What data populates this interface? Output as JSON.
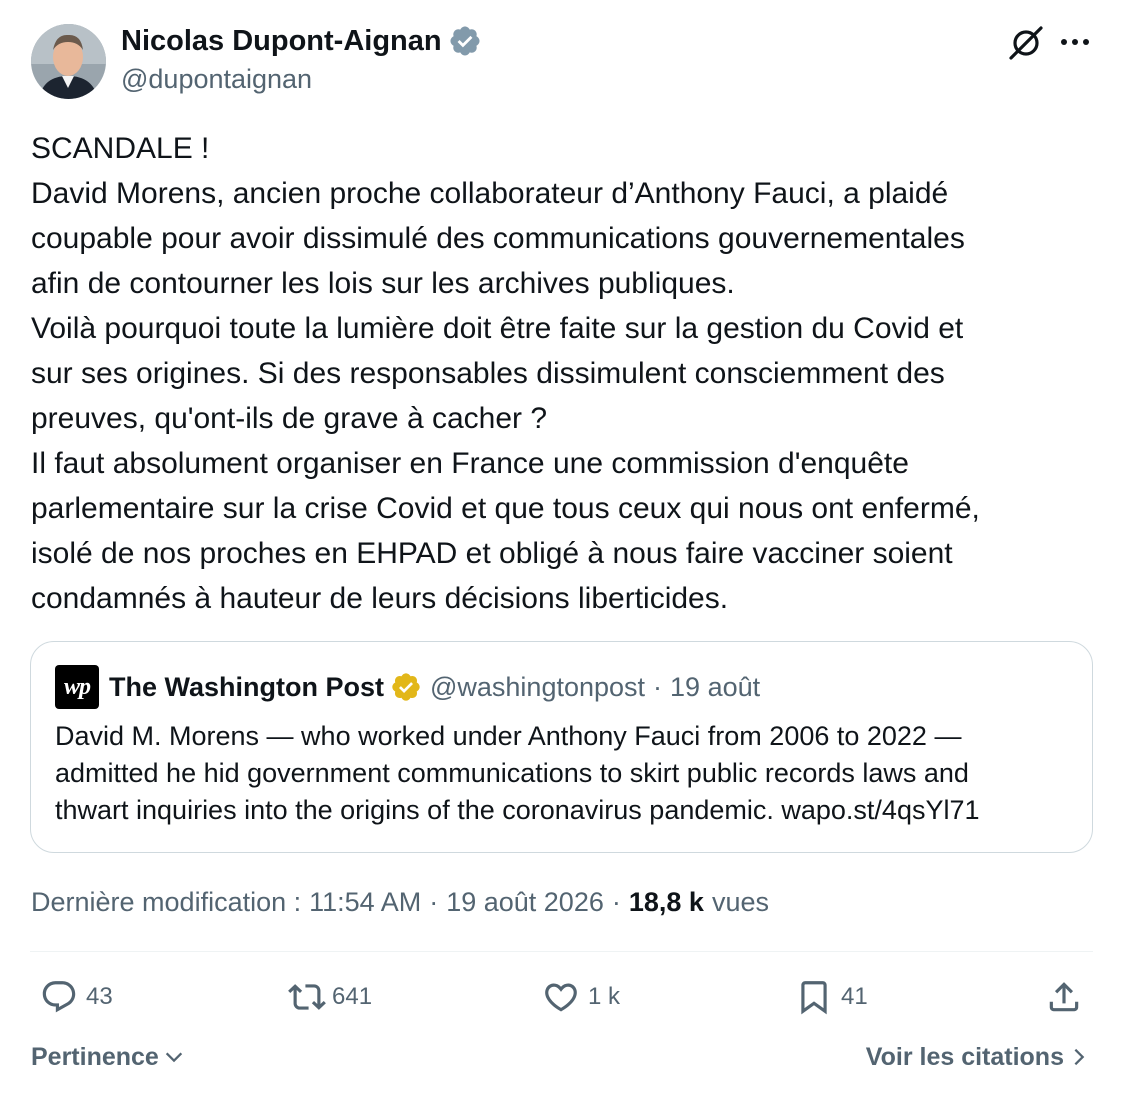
{
  "author": {
    "name": "Nicolas Dupont-Aignan",
    "handle": "@dupontaignan",
    "verified_color": "#829aab"
  },
  "tweet": {
    "lines": [
      "SCANDALE !",
      "David Morens, ancien proche collaborateur d’Anthony Fauci, a plaidé",
      "coupable pour avoir dissimulé des communications gouvernementales",
      "afin de contourner les lois sur les archives publiques.",
      "Voilà pourquoi toute la lumière doit être faite sur la gestion du Covid et",
      "sur ses origines. Si des responsables dissimulent consciemment des",
      "preuves, qu'ont-ils de grave à cacher ?",
      "Il faut absolument organiser en France une commission d'enquête",
      "parlementaire sur la crise Covid et que tous ceux qui nous ont enfermé,",
      "isolé de nos proches en EHPAD et obligé à nous faire vacciner soient",
      "condamnés à hauteur de leurs décisions liberticides."
    ]
  },
  "quote": {
    "logo_text": "wp",
    "author": "The Washington Post",
    "handle": "@washingtonpost",
    "separator": "·",
    "date": "19 août",
    "verified_color": "#e2b719",
    "lines": [
      "David M. Morens — who worked under Anthony Fauci from 2006 to 2022 —",
      "admitted he hid government communications to skirt public records laws and",
      "thwart inquiries into the origins of the coronavirus pandemic. wapo.st/4qsYl71"
    ]
  },
  "meta": {
    "edited_label": "Dernière modification :",
    "time": "11:54 AM",
    "separator": "·",
    "date": "19 août 2026",
    "views_count": "18,8 k",
    "views_label": "vues"
  },
  "actions": {
    "replies": "43",
    "reposts": "641",
    "likes": "1 k",
    "bookmarks": "41"
  },
  "footer": {
    "sort_label": "Pertinence",
    "quotes_label": "Voir les citations"
  },
  "icons": {
    "grok": "grok-icon",
    "more": "more-icon",
    "reply": "reply-icon",
    "repost": "repost-icon",
    "like": "heart-icon",
    "bookmark": "bookmark-icon",
    "share": "share-icon"
  }
}
